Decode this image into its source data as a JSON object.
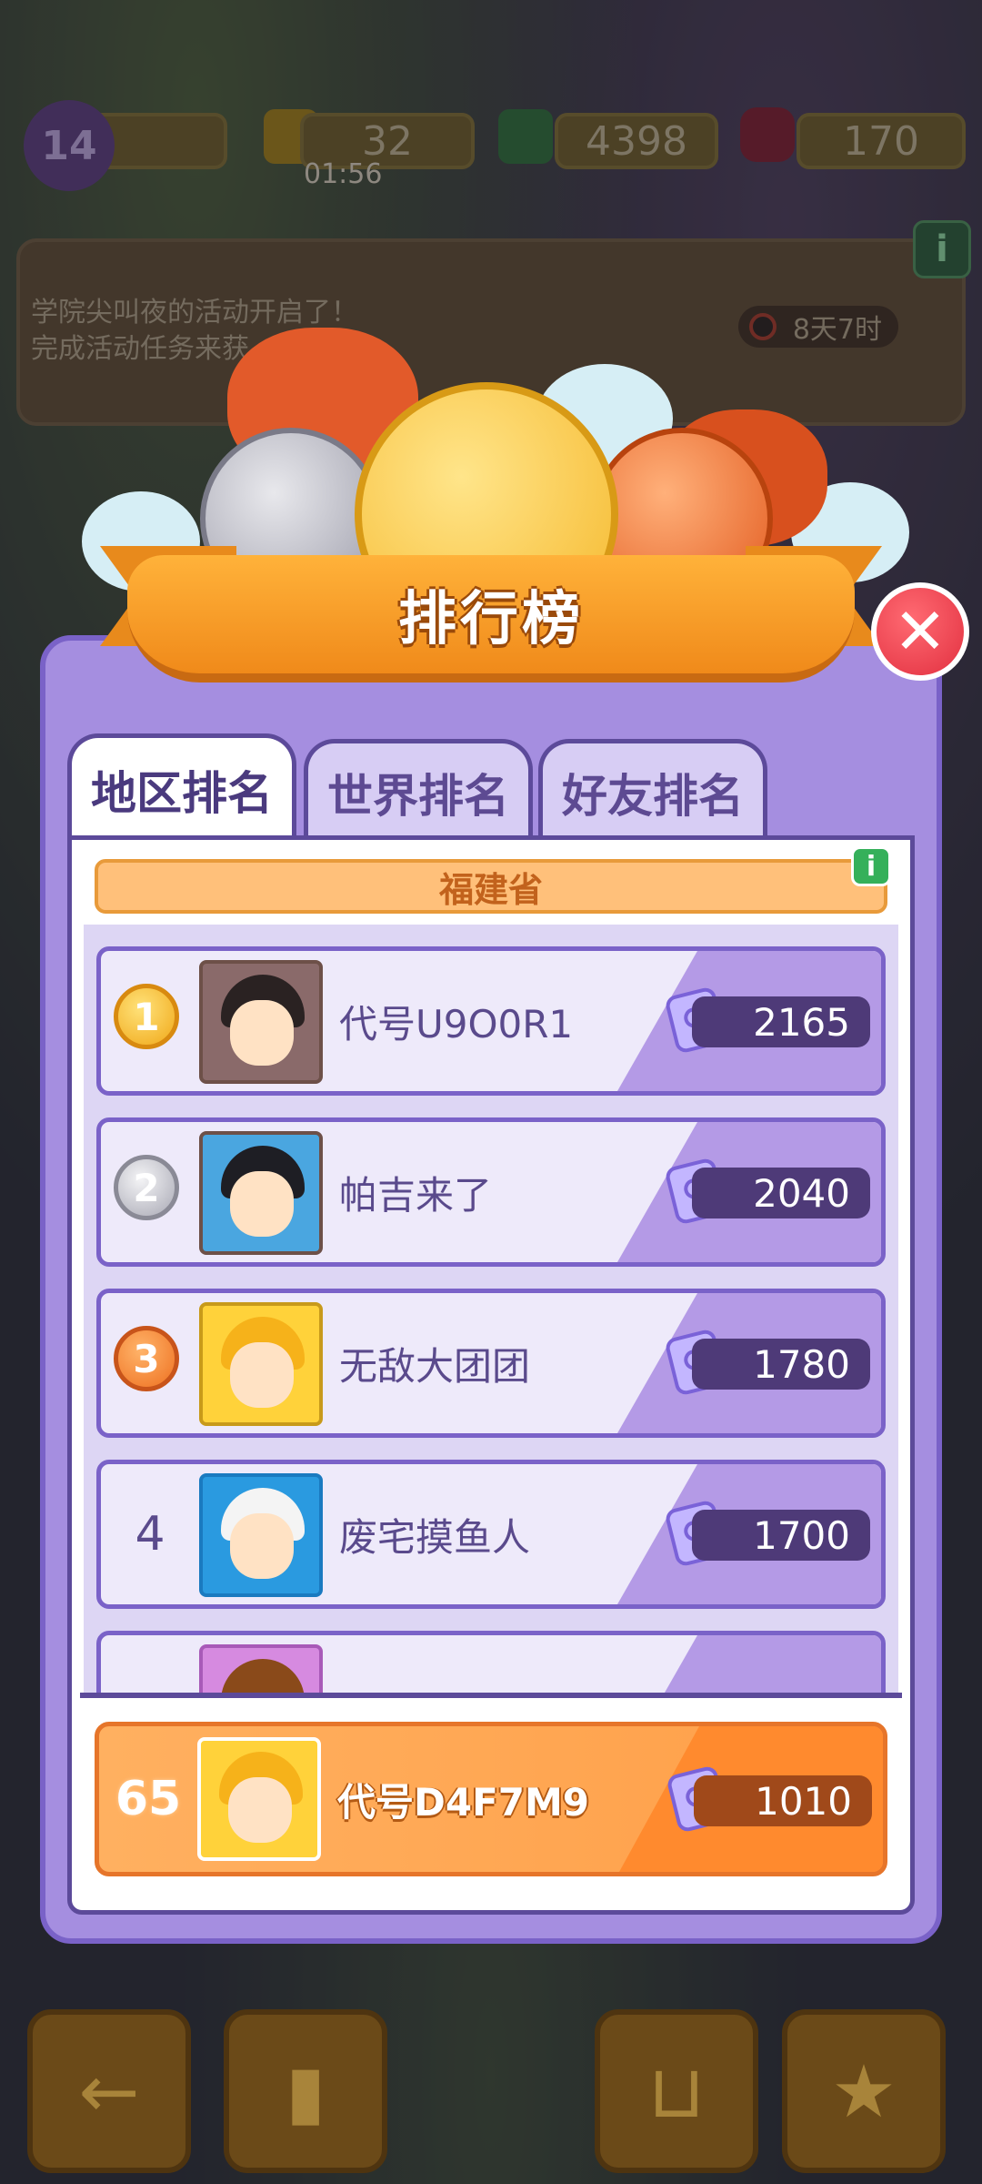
{
  "top_bar": {
    "level": "14",
    "energy": "32",
    "energy_timer": "01:56",
    "cash": "4398",
    "gems": "170"
  },
  "event": {
    "text": "学院尖叫夜的活动开启了！\n完成活动任务来获",
    "timer": "8天7时",
    "info": "i"
  },
  "leaderboard": {
    "title": "排行榜",
    "close_label": "✕",
    "tabs": [
      {
        "label": "地区排名",
        "active": true
      },
      {
        "label": "世界排名",
        "active": false
      },
      {
        "label": "好友排名",
        "active": false
      }
    ],
    "region": "福建省",
    "info": "i",
    "rows": [
      {
        "rank": "1",
        "name": "代号U9O0R1",
        "score": "2165"
      },
      {
        "rank": "2",
        "name": "帕吉来了",
        "score": "2040"
      },
      {
        "rank": "3",
        "name": "无敌大团团",
        "score": "1780"
      },
      {
        "rank": "4",
        "name": "废宅摸鱼人",
        "score": "1700"
      }
    ],
    "me": {
      "rank": "65",
      "name": "代号D4F7M9",
      "score": "1010"
    }
  },
  "colors": {
    "panel": "#a58ee0",
    "panel_border": "#7a62c8",
    "ribbon": "#f4951f",
    "close": "#e23040",
    "my_row": "#ff9f48"
  }
}
